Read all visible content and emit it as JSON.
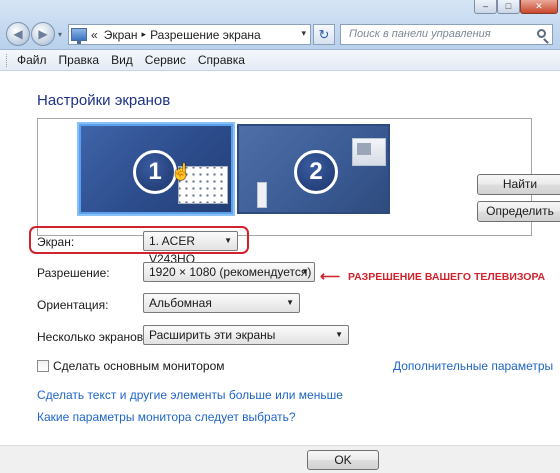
{
  "window": {
    "minimize_glyph": "–",
    "maximize_glyph": "□",
    "close_glyph": "✕"
  },
  "nav": {
    "back_glyph": "◀",
    "forward_glyph": "▶",
    "dropdown_glyph": "▾"
  },
  "address": {
    "prefix": "«",
    "crumbs": [
      "Экран",
      "Разрешение экрана"
    ],
    "separator": "▸",
    "dropdown_glyph": "▾"
  },
  "refresh_glyph": "↻",
  "search": {
    "placeholder": "Поиск в панели управления"
  },
  "menu": {
    "items": [
      "Файл",
      "Правка",
      "Вид",
      "Сервис",
      "Справка"
    ]
  },
  "main": {
    "title": "Настройки экранов",
    "monitor1_number": "1",
    "monitor2_number": "2",
    "find_button": "Найти",
    "identify_button": "Определить",
    "display_label": "Экран:",
    "display_value": "1. ACER V243HQ",
    "resolution_label": "Разрешение:",
    "resolution_value": "1920 × 1080 (рекомендуется)",
    "orientation_label": "Ориентация:",
    "orientation_value": "Альбомная",
    "multiple_label": "Несколько экранов:",
    "multiple_value": "Расширить эти экраны",
    "dropdown_glyph": "▼",
    "primary_checkbox_label": "Сделать основным монитором",
    "advanced_link": "Дополнительные параметры",
    "text_size_link": "Сделать текст и другие элементы больше или меньше",
    "which_settings_link": "Какие параметры монитора следует выбрать?"
  },
  "annotation": {
    "arrow": "⟵",
    "text": "РАЗРЕШЕНИЕ ВАШЕГО ТЕЛЕВИЗОРА",
    "color": "#d2222c"
  },
  "footer": {
    "ok_button": "OK"
  }
}
